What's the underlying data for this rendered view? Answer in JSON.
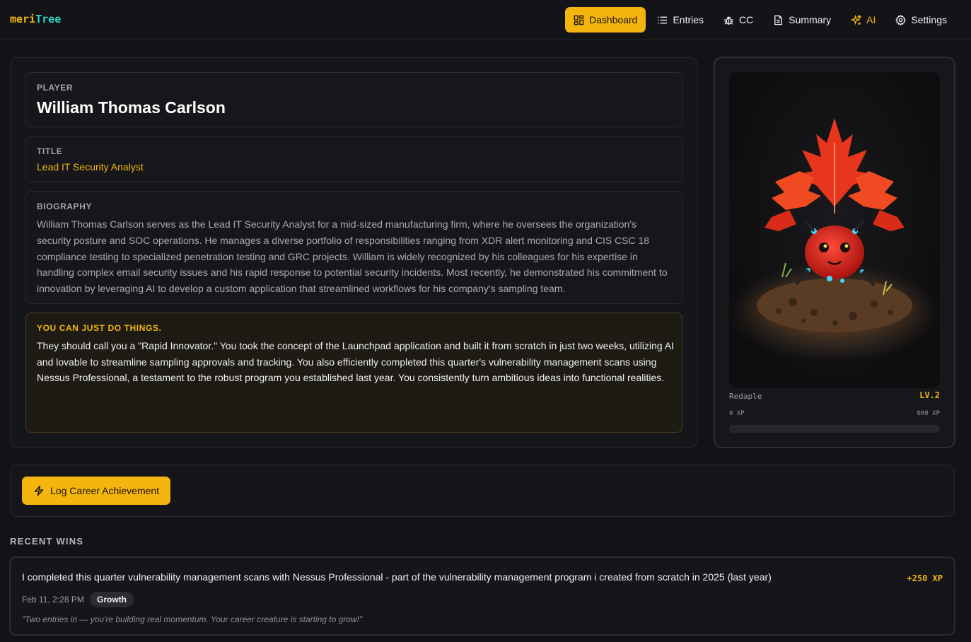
{
  "app": {
    "logo_part1": "meri",
    "logo_part2": "Tree"
  },
  "nav": {
    "items": [
      {
        "label": "Dashboard",
        "icon": "dashboard-grid-icon",
        "active": true
      },
      {
        "label": "Entries",
        "icon": "list-icon"
      },
      {
        "label": "CC",
        "icon": "bug-icon"
      },
      {
        "label": "Summary",
        "icon": "document-icon"
      },
      {
        "label": "AI",
        "icon": "sparkles-icon"
      },
      {
        "label": "Settings",
        "icon": "gear-icon"
      }
    ]
  },
  "profile": {
    "player_label": "PLAYER",
    "player_name": "William Thomas Carlson",
    "title_label": "TITLE",
    "title_value": "Lead IT Security Analyst",
    "bio_label": "BIOGRAPHY",
    "bio_text": "William Thomas Carlson serves as the Lead IT Security Analyst for a mid-sized manufacturing firm, where he oversees the organization's security posture and SOC operations. He manages a diverse portfolio of responsibilities ranging from XDR alert monitoring and CIS CSC 18 compliance testing to specialized penetration testing and GRC projects. William is widely recognized by his colleagues for his expertise in handling complex email security issues and his rapid response to potential security incidents. Most recently, he demonstrated his commitment to innovation by leveraging AI to develop a custom application that streamlined workflows for his company's sampling team.",
    "insight_label": "YOU CAN JUST DO THINGS.",
    "insight_text": "They should call you a \"Rapid Innovator.\" You took the concept of the Launchpad application and built it from scratch in just two weeks, utilizing AI and lovable to streamline sampling approvals and tracking. You also efficiently completed this quarter's vulnerability management scans using Nessus Professional, a testament to the robust program you established last year. You consistently turn ambitious ideas into functional realities."
  },
  "creature": {
    "name": "Redaple",
    "level": "LV.2",
    "xp_min_label": "0 XP",
    "xp_max_label": "600 XP",
    "xp_progress": 0
  },
  "actions": {
    "log_button": "Log Career Achievement",
    "log_icon": "lightning-icon"
  },
  "wins": {
    "heading": "RECENT WINS",
    "items": [
      {
        "text": "I completed this quarter vulnerability management scans with Nessus Professional - part of the vulnerability management program i created from scratch in 2025 (last year)",
        "xp": "+250 XP",
        "date": "Feb 11, 2:28 PM",
        "tag": "Growth",
        "note": "\"Two entries in — you're building real momentum. Your career creature is starting to grow!\""
      }
    ]
  },
  "colors": {
    "accent": "#f5b50f",
    "teal": "#2dd4bf",
    "background": "#121317"
  }
}
